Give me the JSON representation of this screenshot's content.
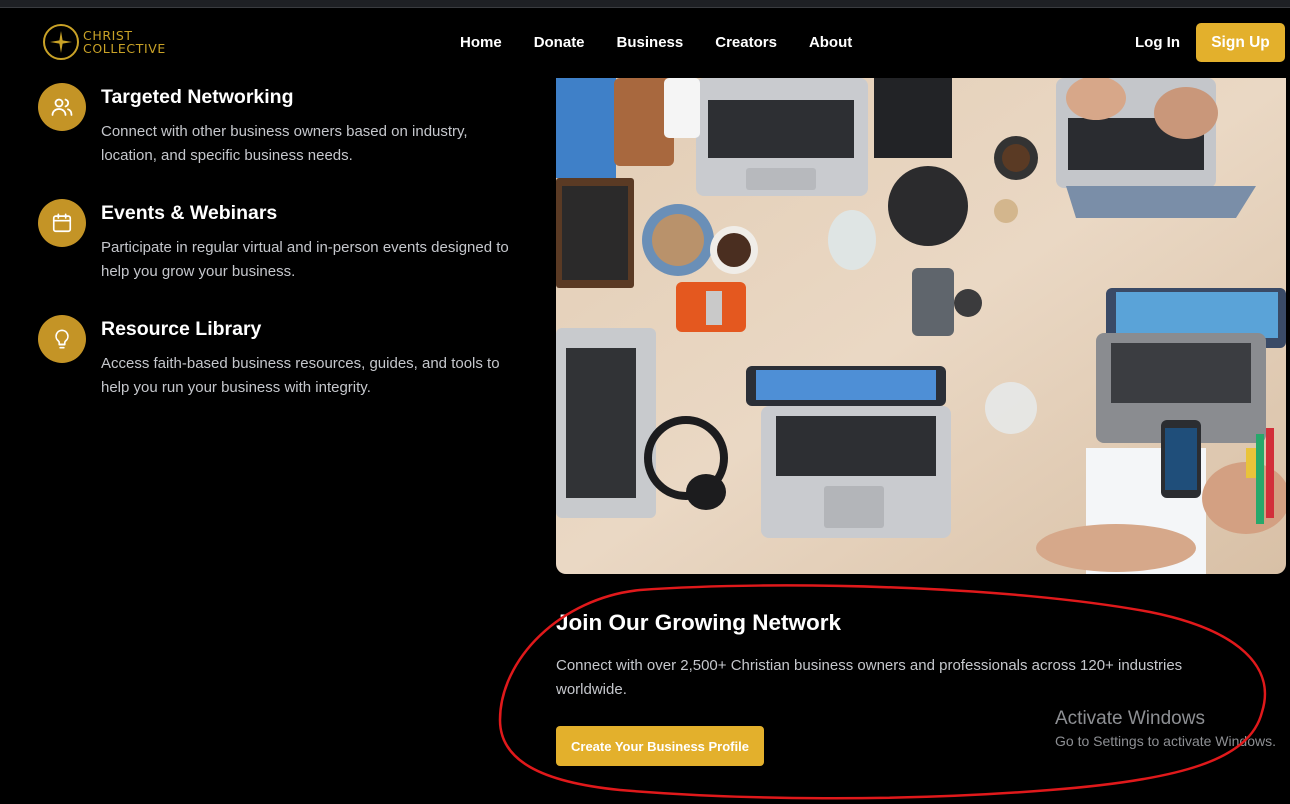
{
  "brand": {
    "line1": "CHRIST",
    "line2": "COLLECTIVE",
    "color": "#c9a227"
  },
  "nav": {
    "items": [
      "Home",
      "Donate",
      "Business",
      "Creators",
      "About"
    ]
  },
  "auth": {
    "login_label": "Log In",
    "signup_label": "Sign Up"
  },
  "features": [
    {
      "icon": "users-icon",
      "title": "Targeted Networking",
      "description": "Connect with other business owners based on industry, location, and specific business needs."
    },
    {
      "icon": "calendar-icon",
      "title": "Events & Webinars",
      "description": "Participate in regular virtual and in-person events designed to help you grow your business."
    },
    {
      "icon": "lightbulb-icon",
      "title": "Resource Library",
      "description": "Access faith-based business resources, guides, and tools to help you run your business with integrity."
    }
  ],
  "cta": {
    "title": "Join Our Growing Network",
    "description": "Connect with over 2,500+ Christian business owners and professionals across 120+ industries worldwide.",
    "button_label": "Create Your Business Profile"
  },
  "watermark": {
    "line1": "Activate Windows",
    "line2": "Go to Settings to activate Windows."
  },
  "colors": {
    "accent": "#e3b02c",
    "icon_bg": "#c49426",
    "annotation": "#e0191b",
    "background": "#000000"
  }
}
